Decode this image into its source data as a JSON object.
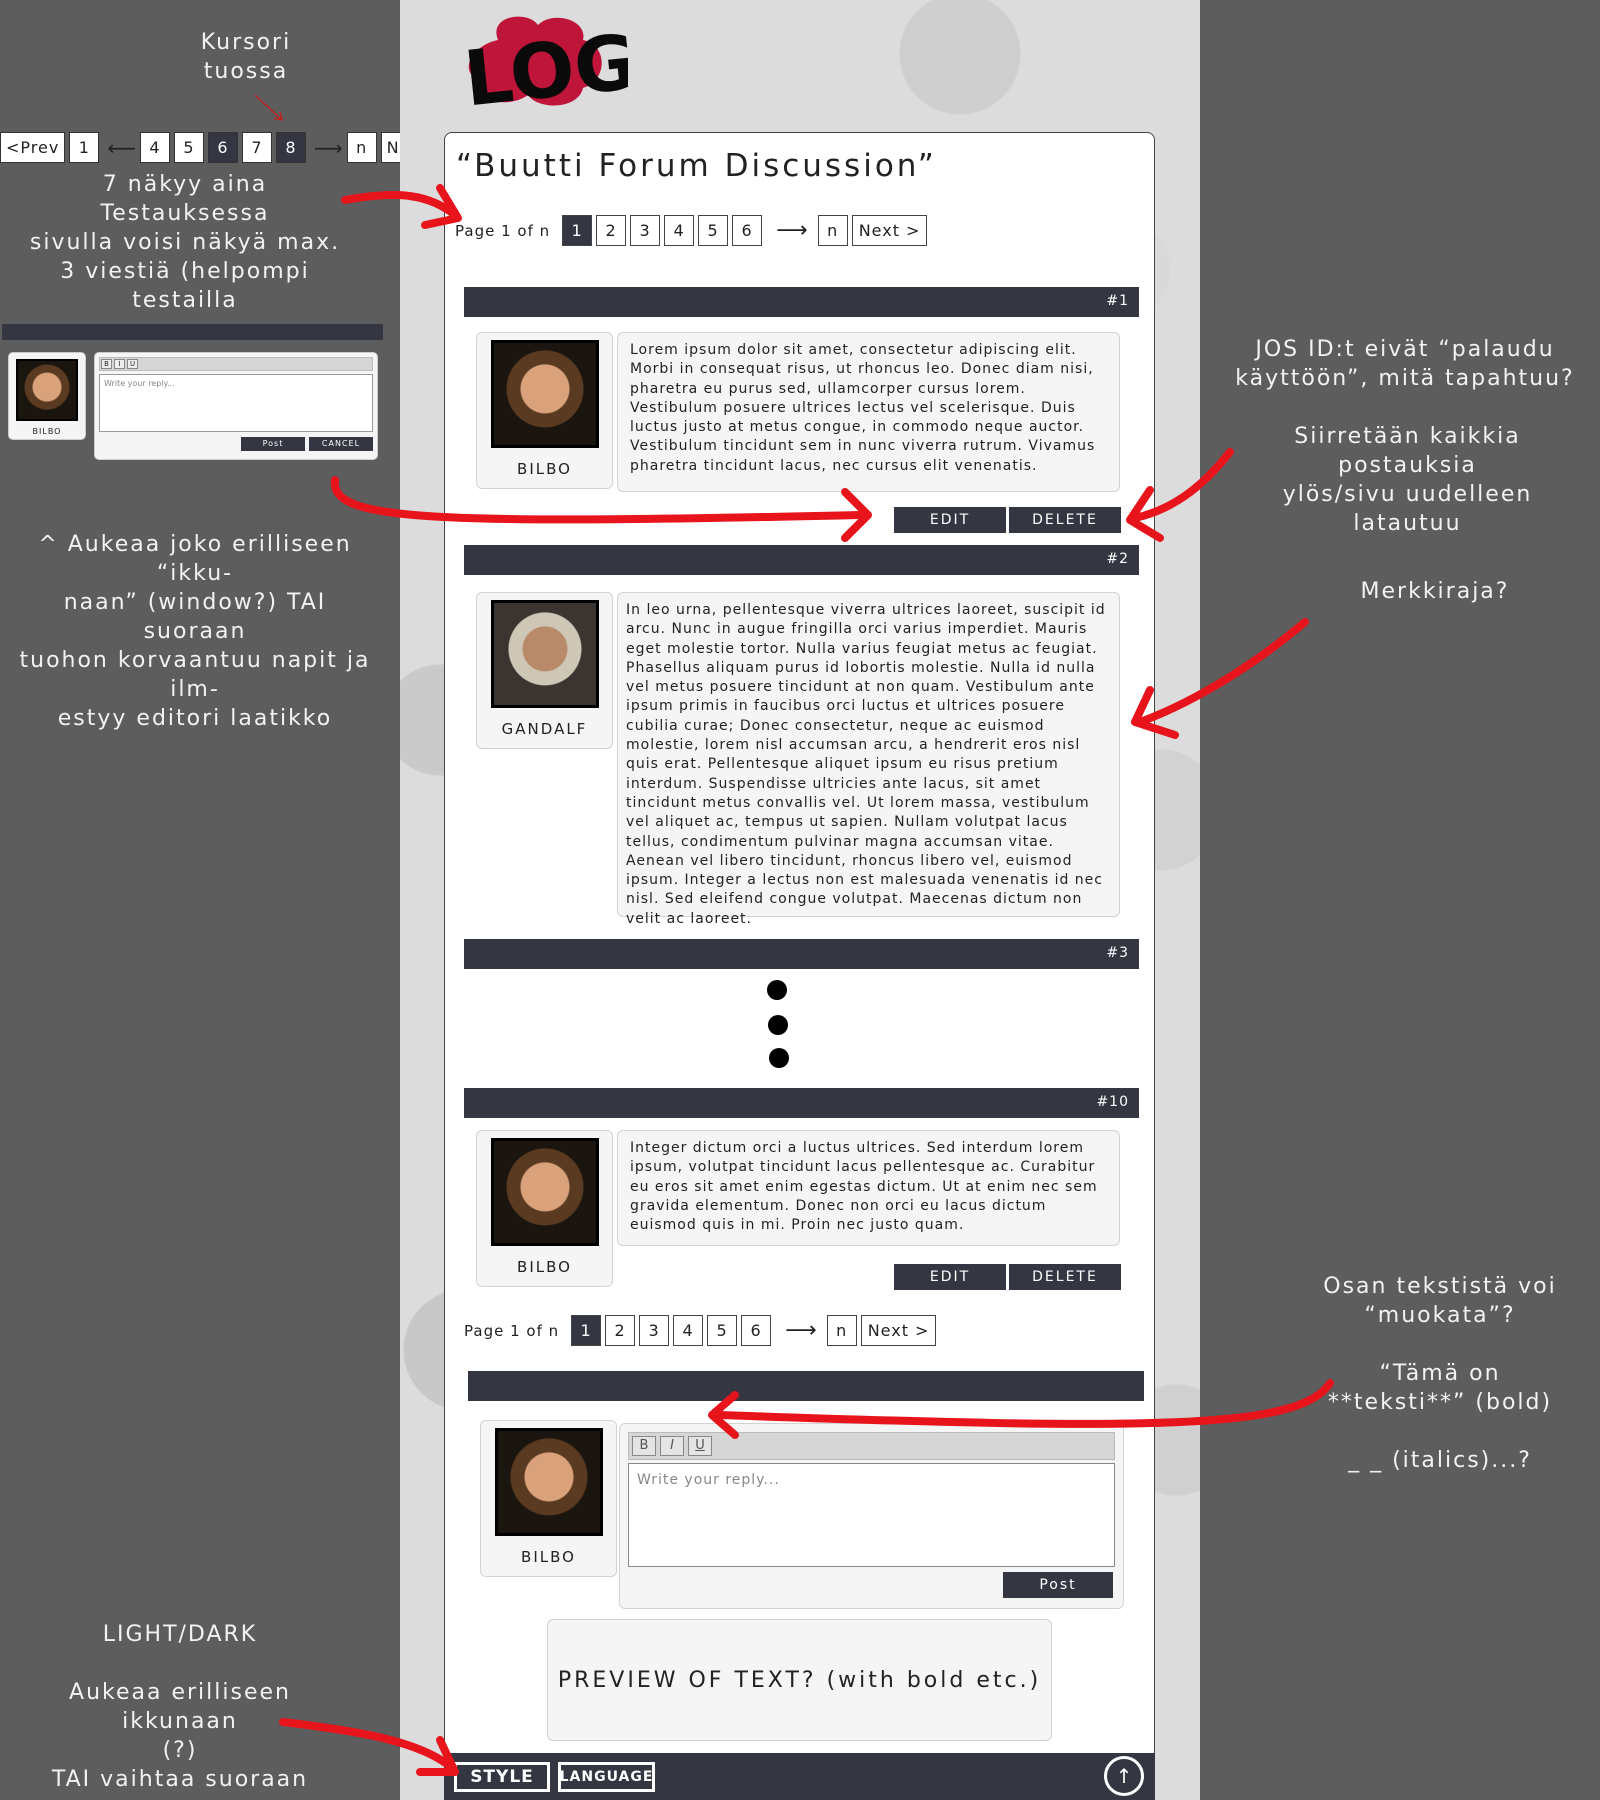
{
  "annotations": {
    "cursor_note": "Kursori\ntuossa",
    "seven_note": "7 näkyy aina\nTestauksessa\nsivulla voisi näkyä max.\n3 viestiä (helpompi\ntestailla",
    "open_note": "^ Aukeaa joko erilliseen “ikku-\nnaan” (window?) TAI suoraan\ntuohon korvaantuu napit ja ilm-\nestyy editori laatikko",
    "ids_note": "JOS ID:t eivät “palaudu\nkäyttöön”, mitä tapahtuu?",
    "move_note": "Siirretään kaikkia postauksia\nylös/sivu uudelleen latautuu",
    "charlimit_note": "Merkkiraja?",
    "edit_note": "Osan tekstistä voi\n“muokata”?\n\n“Tämä on\n**teksti**” (bold)\n\n_ _ (italics)...?",
    "style_note": "LIGHT/DARK\n\nAukeaa erilliseen ikkunaan\n(?)\nTAI vaihtaa suoraan"
  },
  "mini_pager": {
    "prev": "<Prev",
    "pages": [
      "1",
      "4",
      "5",
      "6",
      "7",
      "8",
      "n"
    ],
    "next": "Next >"
  },
  "mini_reply": {
    "user": "BILBO",
    "placeholder": "Write your reply...",
    "post": "Post",
    "cancel": "CANCEL"
  },
  "logo": "LOGO",
  "title": "“Buutti Forum Discussion”",
  "pager": {
    "info": "Page 1 of n",
    "pages": [
      "1",
      "2",
      "3",
      "4",
      "5",
      "6"
    ],
    "last": "n",
    "next": "Next >"
  },
  "posts": [
    {
      "id": "#1",
      "user": "BILBO",
      "text": "Lorem ipsum dolor sit amet, consectetur adipiscing elit. Morbi in consequat risus, ut rhoncus leo. Donec diam nisi, pharetra eu purus sed, ullamcorper cursus lorem. Vestibulum posuere ultrices lectus vel scelerisque. Duis luctus justo at metus congue, in commodo neque auctor. Vestibulum tincidunt sem in nunc viverra rutrum. Vivamus pharetra tincidunt lacus, nec cursus elit venenatis.",
      "edit": "EDIT",
      "delete": "DELETE"
    },
    {
      "id": "#2",
      "user": "GANDALF",
      "text": "In leo urna, pellentesque viverra ultrices laoreet, suscipit id arcu. Nunc in augue fringilla orci varius imperdiet. Mauris eget molestie tortor. Nulla varius feugiat metus ac feugiat. Phasellus aliquam purus id lobortis molestie. Nulla id nulla vel metus posuere tincidunt at non quam. Vestibulum ante ipsum primis in faucibus orci luctus et ultrices posuere cubilia curae; Donec consectetur, neque ac euismod molestie, lorem nisl accumsan arcu, a hendrerit eros nisl quis erat. Pellentesque aliquet ipsum eu risus pretium interdum. Suspendisse ultricies ante lacus, sit amet tincidunt metus convallis vel. Ut lorem massa, vestibulum vel aliquet ac, tempus ut sapien. Nullam volutpat lacus tellus, condimentum pulvinar magna accumsan vitae. Aenean vel libero tincidunt, rhoncus libero vel, euismod ipsum. Integer a lectus non est malesuada venenatis id nec nisl. Sed eleifend congue volutpat. Maecenas dictum non velit ac laoreet."
    },
    {
      "id": "#3"
    },
    {
      "id": "#10",
      "user": "BILBO",
      "text": "Integer dictum orci a luctus ultrices. Sed interdum lorem ipsum, volutpat tincidunt lacus pellentesque ac. Curabitur eu eros sit amet enim egestas dictum. Ut at enim nec sem gravida elementum. Donec non orci eu lacus dictum euismod quis in mi. Proin nec justo quam.",
      "edit": "EDIT",
      "delete": "DELETE"
    }
  ],
  "reply": {
    "user": "BILBO",
    "bold": "B",
    "italic": "I",
    "underline": "U",
    "placeholder": "Write your reply...",
    "post": "Post"
  },
  "preview": "PREVIEW OF TEXT? (with bold etc.)",
  "footer": {
    "style": "STYLE",
    "language": "LANGUAGE",
    "up": "↑"
  },
  "colors": {
    "background": "#5d5d5d",
    "bar": "#343742",
    "card": "#f4f5f4",
    "annotation_red": "#e8141c"
  }
}
